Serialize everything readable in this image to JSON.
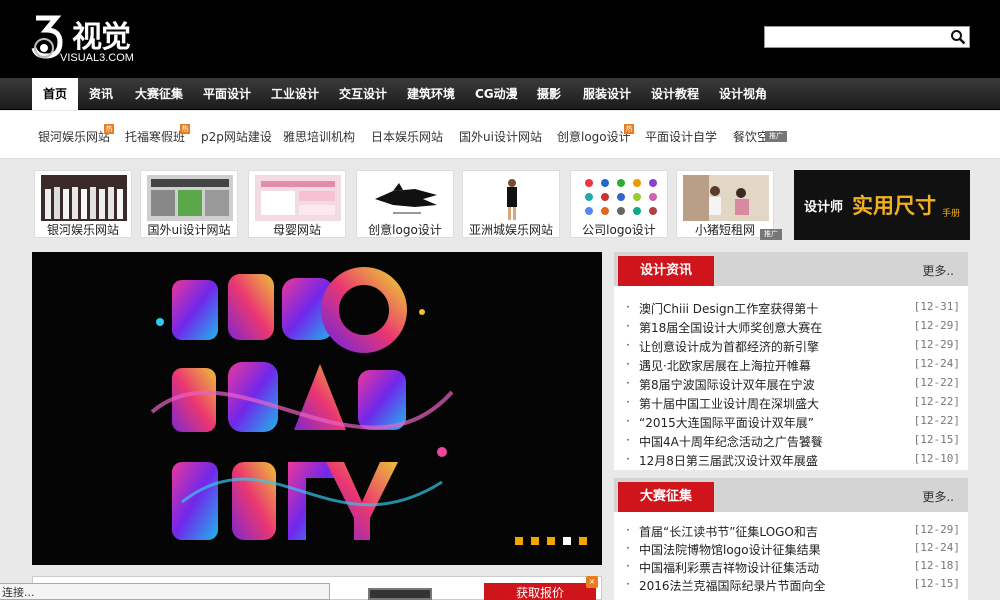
{
  "header": {
    "logo_cn": "视觉",
    "logo_en": "VISUAL3.COM",
    "search": {
      "value": "",
      "placeholder": ""
    }
  },
  "nav": {
    "items": [
      {
        "label": "首页",
        "active": true
      },
      {
        "label": "资讯"
      },
      {
        "label": "大赛征集"
      },
      {
        "label": "平面设计"
      },
      {
        "label": "工业设计"
      },
      {
        "label": "交互设计"
      },
      {
        "label": "建筑环境"
      },
      {
        "label": "CG动漫"
      },
      {
        "label": "摄影"
      },
      {
        "label": "服装设计"
      },
      {
        "label": "设计教程"
      },
      {
        "label": "设计视角"
      }
    ]
  },
  "linkbar": {
    "items": [
      {
        "label": "银河娱乐网站",
        "hot": true
      },
      {
        "label": "托福寒假班",
        "hot": true
      },
      {
        "label": "p2p网站建设"
      },
      {
        "label": "雅思培训机构"
      },
      {
        "label": "日本娱乐网站"
      },
      {
        "label": "国外ui设计网站"
      },
      {
        "label": "创意logo设计",
        "hot": true
      },
      {
        "label": "平面设计自学"
      },
      {
        "label": "餐饮空"
      }
    ],
    "ad_tag": "推广"
  },
  "thumbs": {
    "items": [
      {
        "label": "银河娱乐网站"
      },
      {
        "label": "国外ui设计网站"
      },
      {
        "label": "母婴网站"
      },
      {
        "label": "创意logo设计"
      },
      {
        "label": "亚洲城娱乐网站"
      },
      {
        "label": "公司logo设计"
      },
      {
        "label": "小猪短租网"
      }
    ],
    "ad_tag": "推广"
  },
  "banner": {
    "main": "设计师",
    "big": "实用尺寸",
    "side": "手册"
  },
  "hero": {
    "dot_count": 5,
    "active_dot": 3
  },
  "news": {
    "title": "设计资讯",
    "more": "更多..",
    "items": [
      {
        "text": "澳门Chiii Design工作室获得第十",
        "date": "[12-31]"
      },
      {
        "text": "第18届全国设计大师奖创意大赛在",
        "date": "[12-29]"
      },
      {
        "text": "让创意设计成为首都经济的新引擎",
        "date": "[12-29]"
      },
      {
        "text": "遇见·北欧家居展在上海拉开帷幕",
        "date": "[12-24]"
      },
      {
        "text": "第8届宁波国际设计双年展在宁波",
        "date": "[12-22]"
      },
      {
        "text": "第十届中国工业设计周在深圳盛大",
        "date": "[12-22]"
      },
      {
        "text": "“2015大连国际平面设计双年展”",
        "date": "[12-22]"
      },
      {
        "text": "中国4A十周年纪念活动之广告饕餮",
        "date": "[12-15]"
      },
      {
        "text": "12月8日第三届武汉设计双年展盛",
        "date": "[12-10]"
      }
    ]
  },
  "contest": {
    "title": "大赛征集",
    "more": "更多..",
    "items": [
      {
        "text": "首届“长江读书节”征集LOGO和吉",
        "date": "[12-29]"
      },
      {
        "text": "中国法院博物馆logo设计征集结果",
        "date": "[12-24]"
      },
      {
        "text": "中国福利彩票吉祥物设计征集活动",
        "date": "[12-18]"
      },
      {
        "text": "2016法兰克福国际纪录片节面向全",
        "date": "[12-15]"
      }
    ]
  },
  "lower": {
    "button": "获取报价",
    "close": "×"
  },
  "status_bar": "连接..."
}
